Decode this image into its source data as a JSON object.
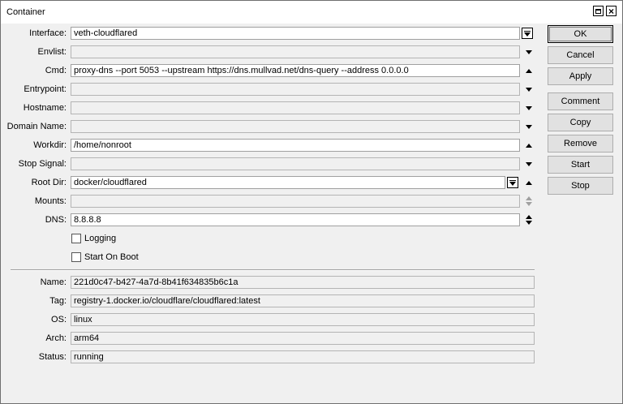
{
  "window": {
    "title": "Container"
  },
  "form": {
    "interface": {
      "label": "Interface:",
      "value": "veth-cloudflared"
    },
    "envlist": {
      "label": "Envlist:",
      "value": ""
    },
    "cmd": {
      "label": "Cmd:",
      "value": "proxy-dns --port 5053 --upstream https://dns.mullvad.net/dns-query --address 0.0.0.0"
    },
    "entrypoint": {
      "label": "Entrypoint:",
      "value": ""
    },
    "hostname": {
      "label": "Hostname:",
      "value": ""
    },
    "domain_name": {
      "label": "Domain Name:",
      "value": ""
    },
    "workdir": {
      "label": "Workdir:",
      "value": "/home/nonroot"
    },
    "stop_signal": {
      "label": "Stop Signal:",
      "value": ""
    },
    "root_dir": {
      "label": "Root Dir:",
      "value": "docker/cloudflared"
    },
    "mounts": {
      "label": "Mounts:",
      "value": ""
    },
    "dns": {
      "label": "DNS:",
      "value": "8.8.8.8"
    },
    "logging": {
      "label": "Logging",
      "checked": false
    },
    "start_on_boot": {
      "label": "Start On Boot",
      "checked": false
    }
  },
  "info": {
    "name": {
      "label": "Name:",
      "value": "221d0c47-b427-4a7d-8b41f634835b6c1a"
    },
    "tag": {
      "label": "Tag:",
      "value": "registry-1.docker.io/cloudflare/cloudflared:latest"
    },
    "os": {
      "label": "OS:",
      "value": "linux"
    },
    "arch": {
      "label": "Arch:",
      "value": "arm64"
    },
    "status": {
      "label": "Status:",
      "value": "running"
    }
  },
  "buttons": {
    "ok": "OK",
    "cancel": "Cancel",
    "apply": "Apply",
    "comment": "Comment",
    "copy": "Copy",
    "remove": "Remove",
    "start": "Start",
    "stop": "Stop"
  }
}
